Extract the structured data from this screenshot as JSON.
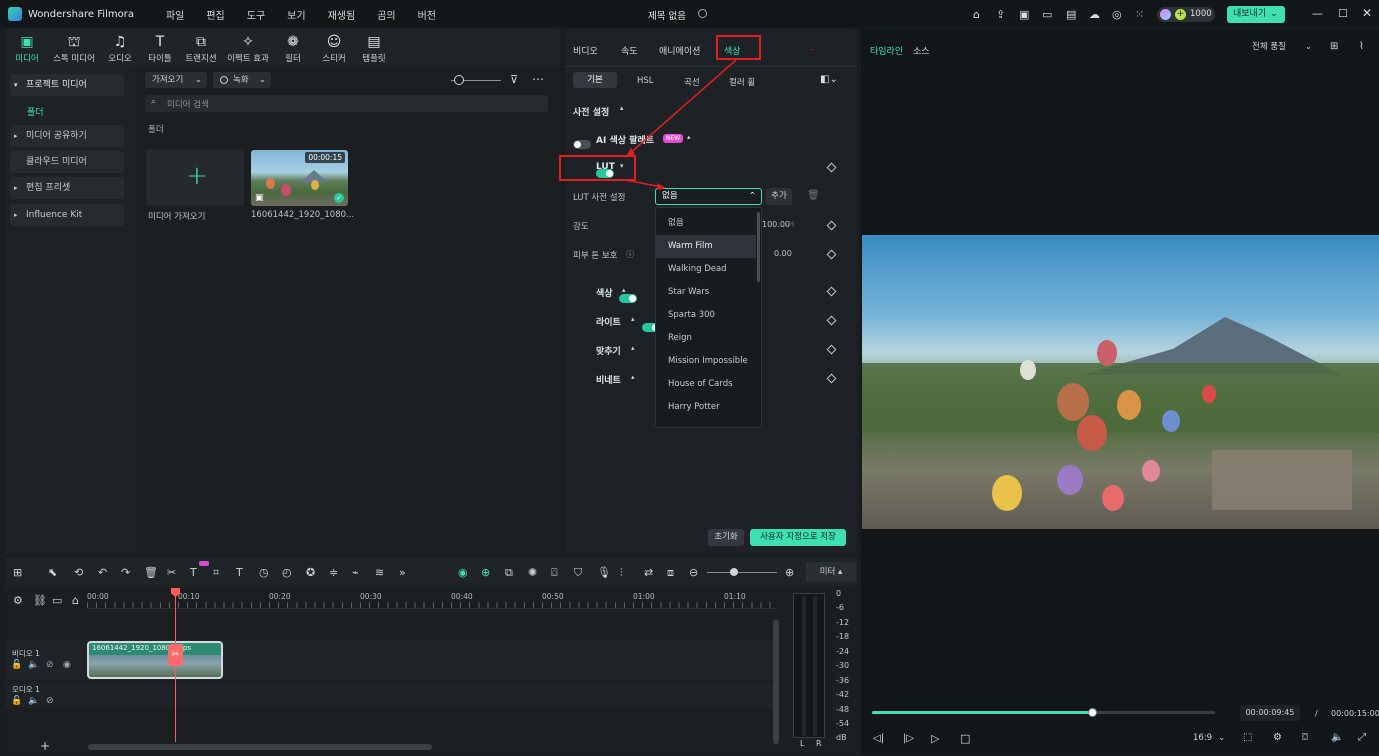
{
  "app": {
    "name": "Wondershare Filmora",
    "project_title": "제목 없음",
    "credits": "1000",
    "export_label": "내보내기"
  },
  "menu": [
    "파일",
    "편집",
    "도구",
    "보기",
    "재생됨",
    "곰의",
    "버전"
  ],
  "media_tabs": [
    {
      "label": "미디어",
      "icon": "media-icon"
    },
    {
      "label": "스톡 미디어",
      "icon": "stock-media-icon"
    },
    {
      "label": "오디오",
      "icon": "audio-icon"
    },
    {
      "label": "타이틀",
      "icon": "title-icon"
    },
    {
      "label": "트랜지션",
      "icon": "transition-icon"
    },
    {
      "label": "이펙트 효과",
      "icon": "effects-icon"
    },
    {
      "label": "필터",
      "icon": "filter-icon"
    },
    {
      "label": "스티커",
      "icon": "sticker-icon"
    },
    {
      "label": "템플릿",
      "icon": "template-icon"
    }
  ],
  "sidebar": {
    "items": [
      "프로젝트 미디어",
      "폴더",
      "미디어 공유하기",
      "클라우드 미디어",
      "편집 프리셋",
      "Influence Kit"
    ]
  },
  "media_toolbar": {
    "import_label": "가져오기",
    "record_label": "녹화",
    "search_placeholder": "미디어 검색",
    "folder_heading": "폴더"
  },
  "media_items": [
    {
      "label": "미디어 가져오기"
    },
    {
      "label": "16061442_1920_1080...",
      "duration": "00:00:15"
    }
  ],
  "props": {
    "tabs": [
      "비디오",
      "속도",
      "애니메이션",
      "색상"
    ],
    "subtabs": [
      "기본",
      "HSL",
      "곡선",
      "컬러 휠"
    ],
    "preset_label": "사전 설정",
    "ai_palette_label": "AI 색상 팔레트",
    "ai_badge": "NEW",
    "lut_label": "LUT",
    "lut_preset_label": "LUT 사전 설정",
    "lut_value": "없음",
    "add_label": "추가",
    "strength_label": "강도",
    "strength_value": "100.00",
    "strength_unit": "%",
    "skin_label": "피부 톤 보호",
    "skin_value": "0.00",
    "sections": [
      "색상",
      "라이트",
      "맞추기",
      "비네트"
    ],
    "lut_options": [
      "없음",
      "Warm Film",
      "Walking Dead",
      "Star Wars",
      "Sparta 300",
      "Reign",
      "Mission Impossible",
      "House of Cards",
      "Harry Potter"
    ],
    "reset_label": "초기화",
    "save_custom_label": "사용자 지정으로 저장"
  },
  "preview": {
    "tabs": [
      "타임라인",
      "소스"
    ],
    "quality": "전체 품질",
    "current_time": "00:00:09:45",
    "separator": "/",
    "total_time": "00:00:15:00",
    "aspect": "16:9",
    "progress": 0.64
  },
  "timeline": {
    "meter_label": "미터",
    "ruler": [
      "00:00",
      "00:10",
      "00:20",
      "00:30",
      "00:40",
      "00:50",
      "01:00",
      "01:10"
    ],
    "meter_scale": [
      "0",
      "-6",
      "-12",
      "-18",
      "-24",
      "-30",
      "-36",
      "-42",
      "-48",
      "-54",
      "dB"
    ],
    "meter_lr": [
      "L",
      "R"
    ],
    "video_track": "비디오 1",
    "audio_track": "오디오 1",
    "clip_label": "16061442_1920_1080_...fps",
    "add_track": "+"
  },
  "colors": {
    "accent": "#26c6a0",
    "highlight": "#e21f1f",
    "playhead": "#ff5a5a"
  }
}
